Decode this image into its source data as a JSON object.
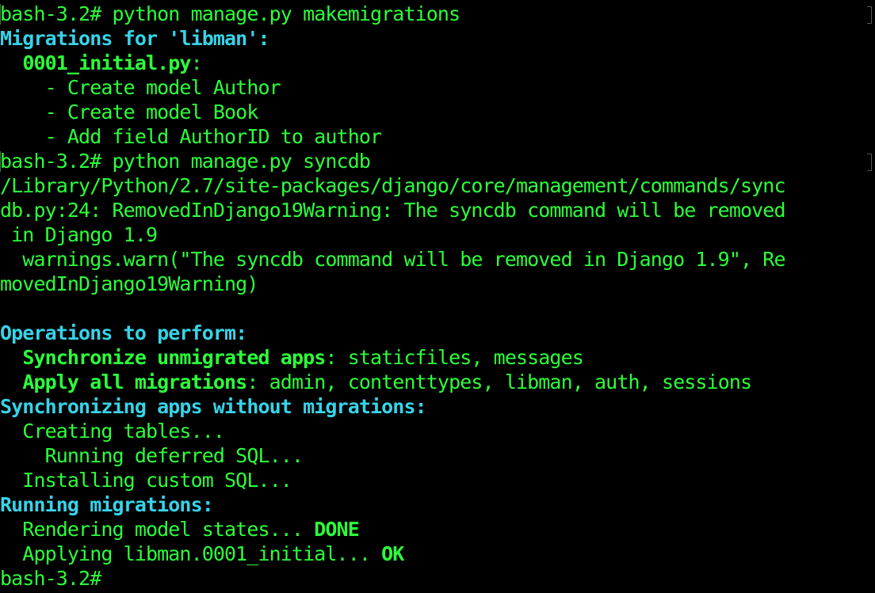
{
  "colors": {
    "background": "#000000",
    "text_green": "#2cff3a",
    "text_cyan": "#37d3e8"
  },
  "terminal": {
    "lines": [
      {
        "prompt": true,
        "frags": [
          {
            "text": "bash-3.2# python manage.py makemigrations",
            "style": "green"
          }
        ]
      },
      {
        "frags": [
          {
            "text": "Migrations for 'libman':",
            "style": "cyan"
          }
        ]
      },
      {
        "frags": [
          {
            "text": "  ",
            "style": "green"
          },
          {
            "text": "0001_initial.py",
            "style": "bold-green"
          },
          {
            "text": ":",
            "style": "green"
          }
        ]
      },
      {
        "frags": [
          {
            "text": "    - Create model Author",
            "style": "green"
          }
        ]
      },
      {
        "frags": [
          {
            "text": "    - Create model Book",
            "style": "green"
          }
        ]
      },
      {
        "frags": [
          {
            "text": "    - Add field AuthorID to author",
            "style": "green"
          }
        ]
      },
      {
        "prompt": true,
        "frags": [
          {
            "text": "bash-3.2# python manage.py syncdb",
            "style": "green"
          }
        ]
      },
      {
        "frags": [
          {
            "text": "/Library/Python/2.7/site-packages/django/core/management/commands/sync",
            "style": "green"
          }
        ]
      },
      {
        "frags": [
          {
            "text": "db.py:24: RemovedInDjango19Warning: The syncdb command will be removed",
            "style": "green"
          }
        ]
      },
      {
        "frags": [
          {
            "text": " in Django 1.9",
            "style": "green"
          }
        ]
      },
      {
        "frags": [
          {
            "text": "  warnings.warn(\"The syncdb command will be removed in Django 1.9\", Re",
            "style": "green"
          }
        ]
      },
      {
        "frags": [
          {
            "text": "movedInDjango19Warning)",
            "style": "green"
          }
        ]
      },
      {
        "frags": [
          {
            "text": "",
            "style": "green"
          }
        ]
      },
      {
        "frags": [
          {
            "text": "Operations to perform:",
            "style": "cyan"
          }
        ]
      },
      {
        "frags": [
          {
            "text": "  ",
            "style": "green"
          },
          {
            "text": "Synchronize unmigrated apps",
            "style": "bold-green"
          },
          {
            "text": ": staticfiles, messages",
            "style": "green"
          }
        ]
      },
      {
        "frags": [
          {
            "text": "  ",
            "style": "green"
          },
          {
            "text": "Apply all migrations",
            "style": "bold-green"
          },
          {
            "text": ": admin, contenttypes, libman, auth, sessions",
            "style": "green"
          }
        ]
      },
      {
        "frags": [
          {
            "text": "Synchronizing apps without migrations:",
            "style": "cyan"
          }
        ]
      },
      {
        "frags": [
          {
            "text": "  Creating tables...",
            "style": "green"
          }
        ]
      },
      {
        "frags": [
          {
            "text": "    Running deferred SQL...",
            "style": "green"
          }
        ]
      },
      {
        "frags": [
          {
            "text": "  Installing custom SQL...",
            "style": "green"
          }
        ]
      },
      {
        "frags": [
          {
            "text": "Running migrations:",
            "style": "cyan"
          }
        ]
      },
      {
        "frags": [
          {
            "text": "  Rendering model states... ",
            "style": "green"
          },
          {
            "text": "DONE",
            "style": "bold-green"
          }
        ]
      },
      {
        "frags": [
          {
            "text": "  Applying libman.0001_initial... ",
            "style": "green"
          },
          {
            "text": "OK",
            "style": "bold-green"
          }
        ]
      },
      {
        "frags": [
          {
            "text": "bash-3.2#",
            "style": "green"
          }
        ]
      }
    ]
  }
}
